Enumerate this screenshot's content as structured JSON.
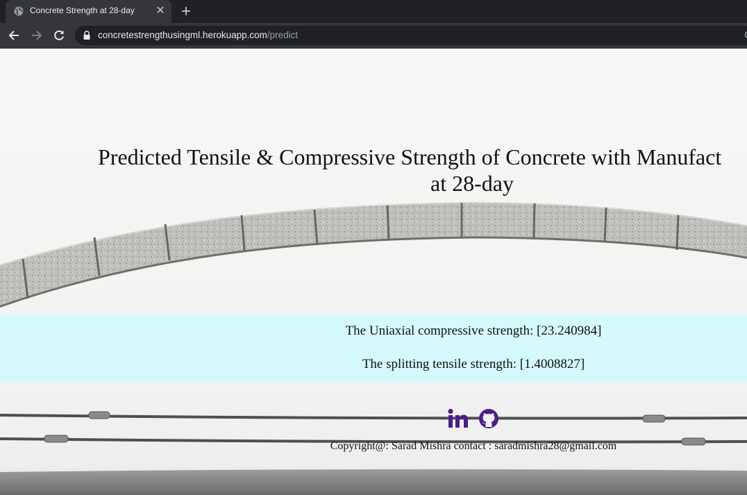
{
  "browser": {
    "tab_title": "Concrete Strength at 28-day",
    "url_domain": "concretestrengthusingml.herokuapp.com",
    "url_path": "/predict"
  },
  "page": {
    "title_line1": "Predicted Tensile & Compressive Strength of Concrete with Manufact",
    "title_line2": "at 28-day",
    "compressive_result": "The Uniaxial compressive strength: [23.240984]",
    "tensile_result": "The splitting tensile strength: [1.4008827]",
    "copyright": "Copyright@: Sarad Mishra contact : saradmishra28@gmail.com",
    "social_icons": [
      "linkedin-icon",
      "github-icon"
    ]
  },
  "colors": {
    "result_band": "#d2fafc",
    "social_icon": "#4b1c8c",
    "chrome_dark": "#202124",
    "chrome_tab": "#35363a"
  }
}
